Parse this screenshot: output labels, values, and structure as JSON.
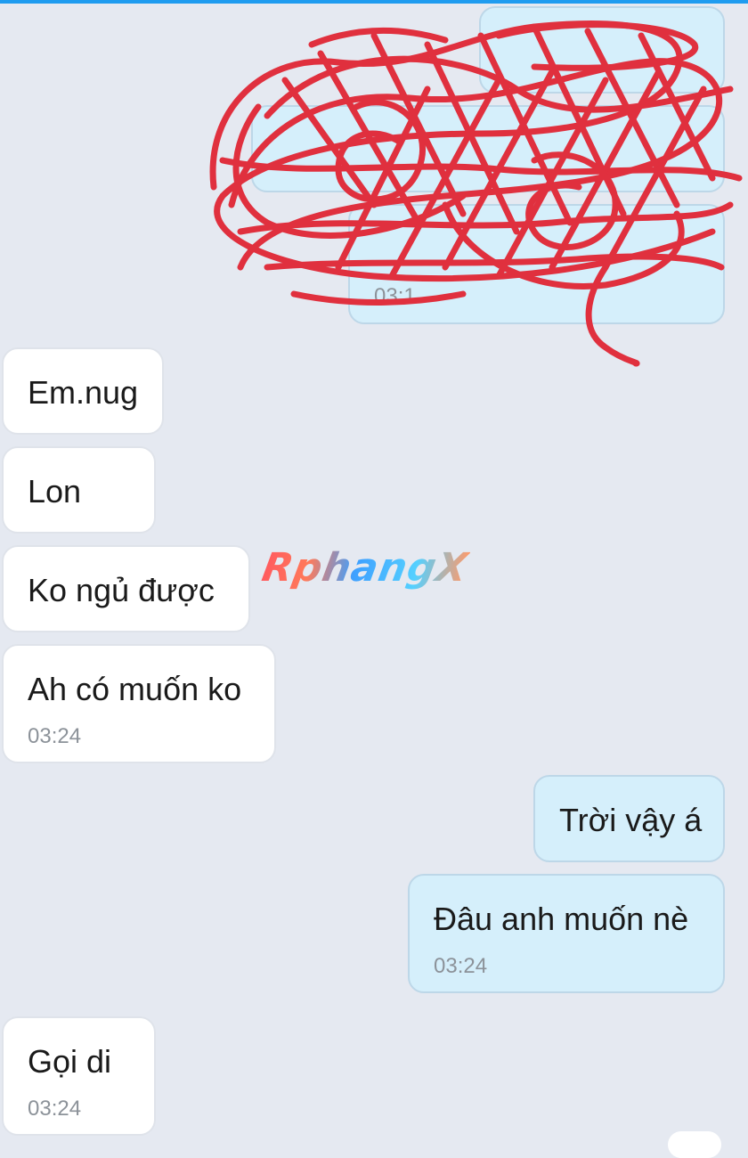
{
  "messages": [
    {
      "side": "out",
      "text": "",
      "time": "",
      "censored": true
    },
    {
      "side": "out",
      "text": "",
      "time": "",
      "censored": true
    },
    {
      "side": "out",
      "text": "",
      "time": "03:1",
      "censored": true
    },
    {
      "side": "in",
      "text": "Em.nug",
      "time": ""
    },
    {
      "side": "in",
      "text": "Lon",
      "time": ""
    },
    {
      "side": "in",
      "text": "Ko ngủ được",
      "time": ""
    },
    {
      "side": "in",
      "text": "Ah có muốn ko",
      "time": "03:24"
    },
    {
      "side": "out",
      "text": "Trời vậy á",
      "time": ""
    },
    {
      "side": "out",
      "text": "Đâu anh muốn nè",
      "time": "03:24"
    },
    {
      "side": "in",
      "text": "Gọi di",
      "time": "03:24"
    }
  ],
  "watermark": "RphangX",
  "colors": {
    "background": "#e5e9f1",
    "incoming_bubble": "#ffffff",
    "outgoing_bubble": "#d5effb",
    "scribble": "#e0303e",
    "top_accent": "#1f9cf0"
  }
}
